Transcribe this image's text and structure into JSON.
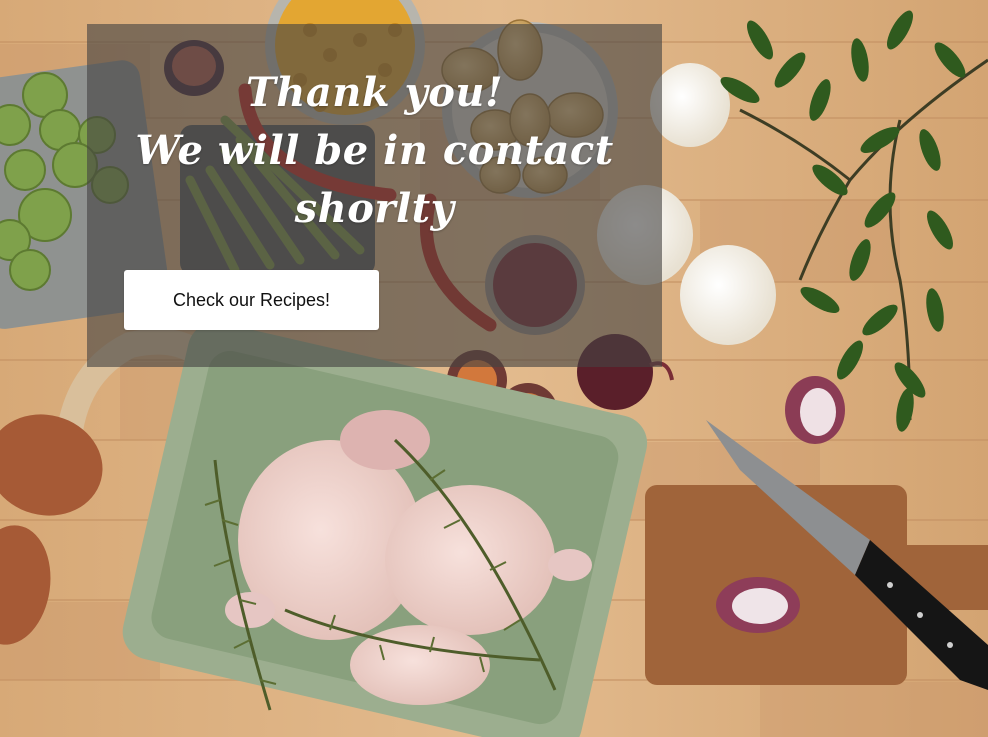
{
  "message": {
    "line1": "Thank you!",
    "line2": "We will be in contact",
    "line3": "shorlty"
  },
  "cta": {
    "label": "Check our Recipes!"
  },
  "colors": {
    "overlay": "#464442",
    "heading_text": "#ffffff",
    "button_bg": "#ffffff",
    "button_text": "#111111",
    "wood": "#d9b084"
  }
}
